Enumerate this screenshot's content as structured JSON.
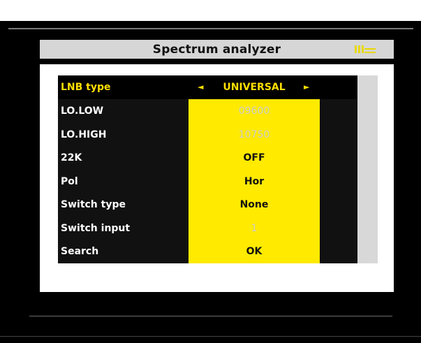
{
  "header": {
    "title": "Spectrum analyzer",
    "icon": "signal-strength-icon"
  },
  "menu": {
    "rows": [
      {
        "label": "LNB type",
        "value": "UNIVERSAL",
        "selected": true
      },
      {
        "label": "LO.LOW",
        "value": "09600",
        "disabled": true
      },
      {
        "label": "LO.HIGH",
        "value": "10750",
        "disabled": true
      },
      {
        "label": "22K",
        "value": "OFF"
      },
      {
        "label": "Pol",
        "value": "Hor"
      },
      {
        "label": "Switch type",
        "value": "None"
      },
      {
        "label": "Switch input",
        "value": "1",
        "disabled": true
      },
      {
        "label": "Search",
        "value": "OK"
      }
    ],
    "arrows": {
      "left": "◄",
      "right": "►"
    }
  },
  "colors": {
    "highlight": "#ffea00",
    "selected_text": "#ffdf00",
    "background": "#000000"
  }
}
